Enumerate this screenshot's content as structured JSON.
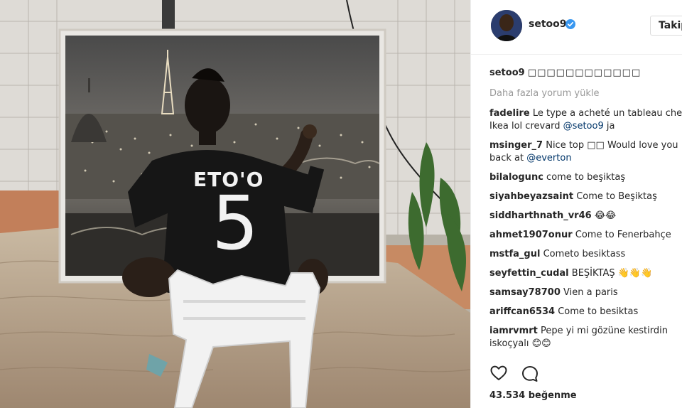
{
  "post": {
    "username": "setoo9",
    "follow_label": "Takip",
    "caption_user": "setoo9",
    "caption_text": "□□□□□□□□□□□□",
    "load_more": "Daha fazla yorum yükle",
    "likes": "43.534 beğenme"
  },
  "comments": [
    {
      "user": "fadelire",
      "text": "Le type a acheté un tableau chez",
      "line2": "Ikea lol crevard ",
      "mention": "@setoo9",
      "after": " ja"
    },
    {
      "user": "msinger_7",
      "text": "Nice top □□ Would love you",
      "line2": "back at ",
      "mention": "@everton",
      "after": ""
    },
    {
      "user": "bilalogunc",
      "text": "come to beşiktaş"
    },
    {
      "user": "siyahbeyazsaint",
      "text": "Come to Beşiktaş"
    },
    {
      "user": "siddharthnath_vr46",
      "text": "😂😂"
    },
    {
      "user": "ahmet1907onur",
      "text": "Come to Fenerbahçe"
    },
    {
      "user": "mstfa_gul",
      "text": "Cometo besiktass"
    },
    {
      "user": "seyfettin_cudal",
      "text": "BEŞİKTAŞ 👋👋👋"
    },
    {
      "user": "samsay78700",
      "text": "Vien a paris"
    },
    {
      "user": "ariffcan6534",
      "text": "Come to besiktas"
    },
    {
      "user": "iamrvmrt",
      "text": "Pepe yi mi gözüne kestirdin",
      "line2": "iskoçyalı 😊😊"
    }
  ],
  "photo": {
    "jersey_name": "ETO'O",
    "jersey_number": "5"
  },
  "colors": {
    "accent_blue": "#3897f0",
    "mention": "#003569"
  },
  "icons": [
    "verified-icon",
    "heart-icon",
    "comment-bubble-icon"
  ]
}
